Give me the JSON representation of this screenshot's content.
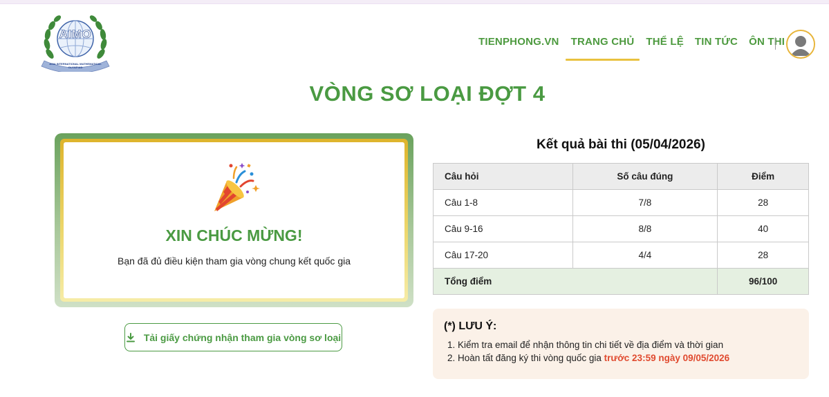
{
  "logo": {
    "text": "AIMO",
    "ribbon_text": "ASIA INTERNATIONAL MATHEMATICAL OLYMPIAD"
  },
  "nav": {
    "items": [
      {
        "label": "TIENPHONG.VN"
      },
      {
        "label": "TRANG CHỦ",
        "active": true
      },
      {
        "label": "THỂ LỆ"
      },
      {
        "label": "TIN TỨC"
      },
      {
        "label": "ÔN THI"
      }
    ]
  },
  "page": {
    "title": "VÒNG SƠ LOẠI ĐỢT 4"
  },
  "congrats": {
    "icon": "party-popper-icon",
    "title": "XIN CHÚC MỪNG!",
    "message": "Bạn đã đủ điều kiện tham gia vòng chung kết quốc gia"
  },
  "certificate_button": {
    "icon": "download-icon",
    "label": "Tải giấy chứng nhận tham gia vòng sơ loại"
  },
  "results": {
    "title": "Kết quả bài thi (05/04/2026)",
    "headers": [
      "Câu hỏi",
      "Số câu đúng",
      "Điểm"
    ],
    "rows": [
      {
        "question": "Câu 1-8",
        "correct": "7/8",
        "score": "28"
      },
      {
        "question": "Câu 9-16",
        "correct": "8/8",
        "score": "40"
      },
      {
        "question": "Câu 17-20",
        "correct": "4/4",
        "score": "28"
      }
    ],
    "total_label": "Tổng điểm",
    "total_value": "96/100"
  },
  "note": {
    "title": "(*) LƯU Ý:",
    "item1": "1. Kiểm tra email để nhận thông tin chi tiết về địa điểm và thời gian",
    "item2_prefix": "2. Hoàn tất đăng ký thi vòng quốc gia",
    "item2_highlight": "trước 23:59 ngày 09/05/2026"
  },
  "colors": {
    "brand_green": "#4a9a42",
    "accent_gold": "#e9c23f",
    "deadline_red": "#e04a2f"
  }
}
